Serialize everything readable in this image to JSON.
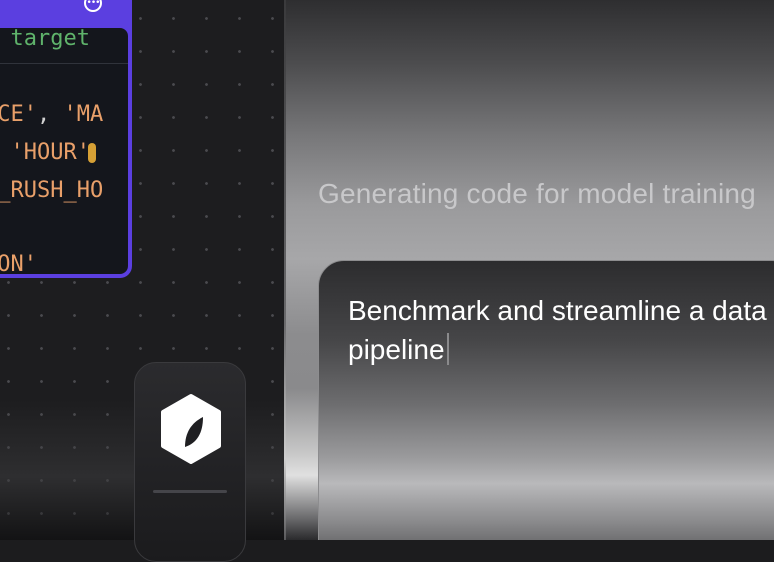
{
  "code_editor": {
    "comment_line": "d target",
    "lines": [
      {
        "str": "NCE'",
        "punc": ", ",
        "str2": "'MA"
      },
      {
        "punc_lead": ", ",
        "str": "'HOUR'"
      },
      {
        "str": "S_RUSH_HO"
      },
      {
        "str": "ION'"
      }
    ],
    "menu_icon": "more-horizontal-icon",
    "accent_color": "#5b3fe0"
  },
  "app_tile": {
    "icon": "hexagon-leaf-logo-icon"
  },
  "status": {
    "text": "Generating code for model training"
  },
  "prompt": {
    "text": "Benchmark and streamline a data pipeline"
  }
}
